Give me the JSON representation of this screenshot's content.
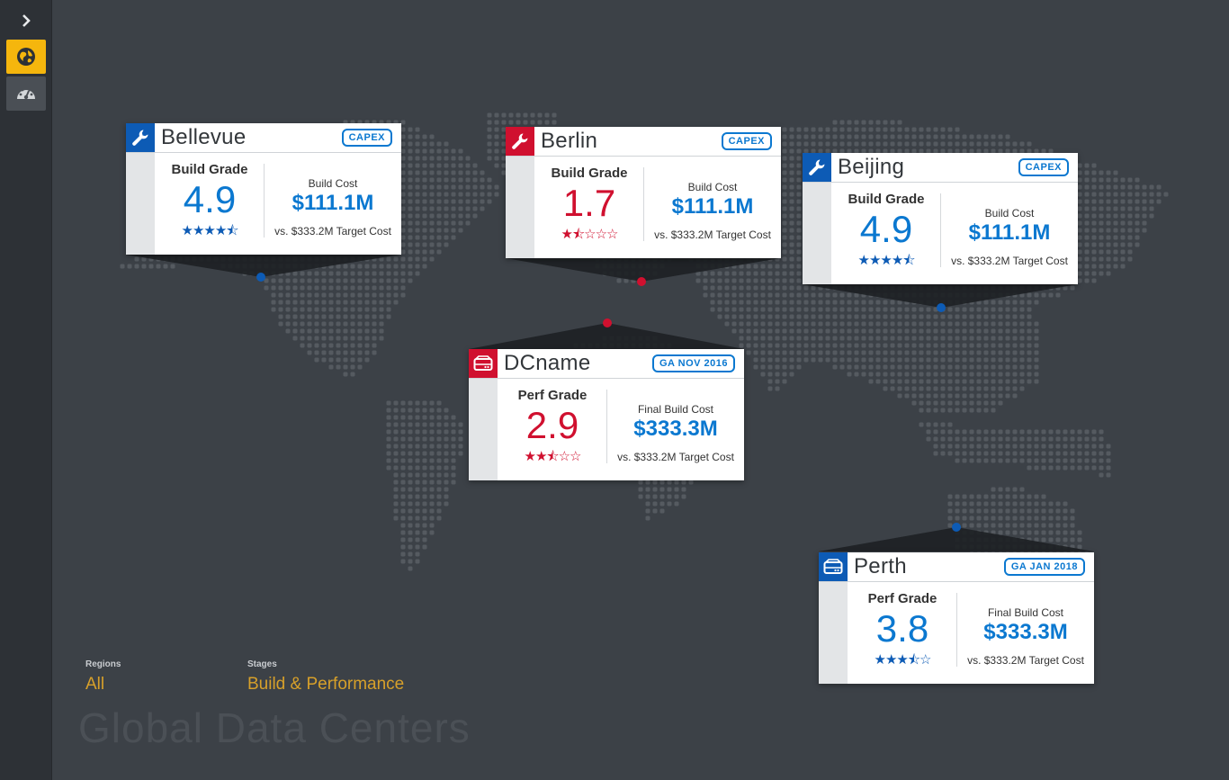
{
  "sidebar": {
    "expand_icon": "chevron-right-icon",
    "items": [
      {
        "icon": "globe-icon",
        "active": true,
        "color": "#f5b60d"
      },
      {
        "icon": "dashboard-gauge-icon",
        "active": false
      }
    ]
  },
  "colors": {
    "accent_blue": "#0b78d0",
    "accent_red": "#d0102f",
    "filter_gold": "#d7a02a",
    "background": "#3c4147"
  },
  "cards": [
    {
      "id": "bellevue",
      "name": "Bellevue",
      "icon": "wrench-icon",
      "color": "blue",
      "badge": "CAPEX",
      "grade_label": "Build Grade",
      "grade": "4.9",
      "stars": "★★★★⯪",
      "stars_value": 4.5,
      "cost_label": "Build Cost",
      "cost": "$111.1M",
      "target": "vs. $333.2M Target Cost"
    },
    {
      "id": "berlin",
      "name": "Berlin",
      "icon": "wrench-icon",
      "color": "red",
      "badge": "CAPEX",
      "grade_label": "Build Grade",
      "grade": "1.7",
      "stars": "★⯪☆☆☆",
      "stars_value": 1.5,
      "cost_label": "Build Cost",
      "cost": "$111.1M",
      "target": "vs. $333.2M Target Cost"
    },
    {
      "id": "beijing",
      "name": "Beijing",
      "icon": "wrench-icon",
      "color": "blue",
      "badge": "CAPEX",
      "grade_label": "Build Grade",
      "grade": "4.9",
      "stars": "★★★★⯪",
      "stars_value": 4.5,
      "cost_label": "Build Cost",
      "cost": "$111.1M",
      "target": "vs. $333.2M Target Cost"
    },
    {
      "id": "dcname",
      "name": "DCname",
      "icon": "server-icon",
      "color": "red",
      "badge": "GA NOV 2016",
      "grade_label": "Perf Grade",
      "grade": "2.9",
      "stars": "★★⯪☆☆",
      "stars_value": 2.5,
      "cost_label": "Final Build Cost",
      "cost": "$333.3M",
      "target": "vs. $333.2M Target Cost"
    },
    {
      "id": "perth",
      "name": "Perth",
      "icon": "server-icon",
      "color": "blue",
      "badge": "GA JAN 2018",
      "grade_label": "Perf Grade",
      "grade": "3.8",
      "stars": "★★★⯪☆",
      "stars_value": 3.5,
      "cost_label": "Final Build Cost",
      "cost": "$333.3M",
      "target": "vs. $333.2M Target Cost"
    }
  ],
  "filters": {
    "regions_label": "Regions",
    "regions_value": "All",
    "stages_label": "Stages",
    "stages_value": "Build & Performance"
  },
  "page_title": "Global Data Centers"
}
